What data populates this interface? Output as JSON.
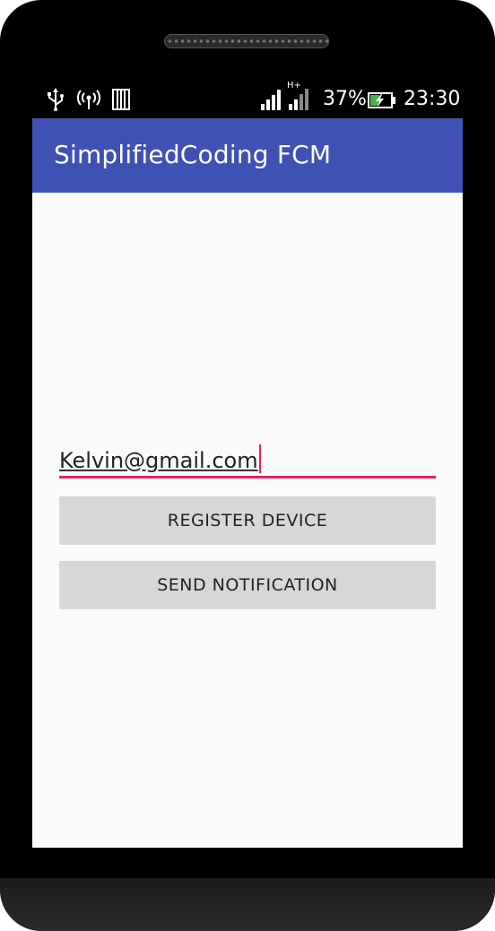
{
  "status_bar": {
    "icons": [
      "usb-icon",
      "wireless-tether-icon",
      "memory-icon",
      "signal-icon",
      "hplus-signal-icon",
      "battery-charging-icon"
    ],
    "network_type": "H+",
    "battery_percent": "37%",
    "time": "23:30"
  },
  "app_bar": {
    "title": "SimplifiedCoding FCM"
  },
  "email_input": {
    "value": "Kelvin@gmail.com"
  },
  "buttons": {
    "register": "REGISTER DEVICE",
    "send": "SEND NOTIFICATION"
  },
  "colors": {
    "primary": "#3f51b5",
    "accent": "#e91e63",
    "button_bg": "#d6d7d7",
    "screen_bg": "#fafafa"
  }
}
